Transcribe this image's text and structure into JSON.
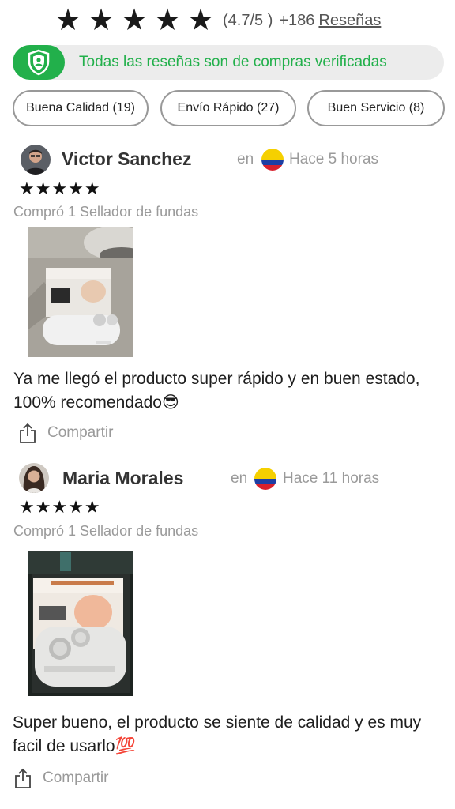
{
  "rating": {
    "stars": [
      "★",
      "★",
      "★",
      "★",
      "★"
    ],
    "score_text": "(4.7/5 )",
    "count_text": "+186",
    "reviews_link": "Reseñas"
  },
  "verified": {
    "text": "Todas las reseñas son de compras verificadas",
    "icon": "shield-user-icon",
    "color": "#22b04b"
  },
  "tags": [
    {
      "label": "Buena Calidad (19)"
    },
    {
      "label": "Envío Rápido (27)"
    },
    {
      "label": "Buen Servicio (8)"
    }
  ],
  "reviews": [
    {
      "name": "Victor Sanchez",
      "in_word": "en",
      "country_flag": "colombia-flag",
      "time": "Hace 5 horas",
      "stars": "★★★★★",
      "purchased": "Compró 1 Sellador de fundas",
      "text": "Ya me llegó el producto super rápido y en buen estado, 100% recomendado😎",
      "share_label": "Compartir"
    },
    {
      "name": "Maria Morales",
      "in_word": "en",
      "country_flag": "colombia-flag",
      "time": "Hace 11 horas",
      "stars": "★★★★★",
      "purchased": "Compró 1 Sellador de fundas",
      "text": "Super bueno, el producto se siente de calidad y es muy facil de usarlo💯",
      "share_label": "Compartir"
    }
  ]
}
